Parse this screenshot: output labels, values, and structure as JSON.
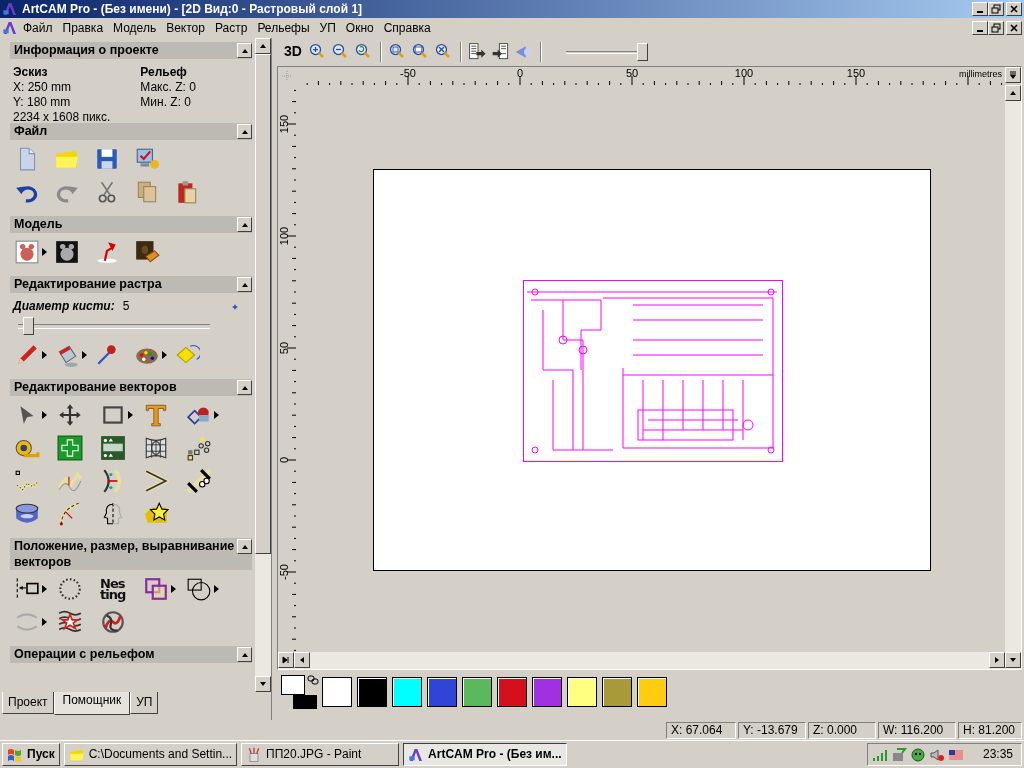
{
  "window": {
    "title": "ArtCAM Pro - (Без имени) - [2D Вид:0 - Растровый слой 1]"
  },
  "menu": [
    "Файл",
    "Правка",
    "Модель",
    "Вектор",
    "Растр",
    "Рельефы",
    "УП",
    "Окно",
    "Справка"
  ],
  "toolbar": {
    "mode_label": "3D",
    "zoom_slider": {
      "level": 0.95
    }
  },
  "panel": {
    "project_info": {
      "title": "Информация о проекте",
      "columns": [
        {
          "heading": "Эскиз",
          "lines": [
            "X: 250 mm",
            "Y: 180 mm",
            "2234 x 1608 пикс."
          ]
        },
        {
          "heading": "Рельеф",
          "lines": [
            "Макс. Z: 0",
            "Мин. Z: 0"
          ]
        }
      ]
    },
    "sections": [
      {
        "title": "Файл",
        "kind": "tools"
      },
      {
        "title": "Модель",
        "kind": "tools"
      },
      {
        "title": "Редактирование растра",
        "kind": "brush",
        "brush_label": "Диаметр кисти:",
        "brush_value": "5",
        "level": 0.05
      },
      {
        "title": "Редактирование векторов",
        "kind": "tools"
      },
      {
        "title": "Положение, размер, выравнивание векторов",
        "kind": "tools",
        "nesting_label": [
          "Nes",
          "ting"
        ]
      },
      {
        "title": "Операции с рельефом",
        "kind": "tools"
      }
    ],
    "tabs": [
      {
        "label": "Проект",
        "selected": false
      },
      {
        "label": "Помощник",
        "selected": true
      },
      {
        "label": "УП",
        "selected": false
      }
    ]
  },
  "rulers": {
    "horizontal": [
      "-50",
      "0",
      "50",
      "100",
      "150"
    ],
    "unit": "millimetres",
    "vertical": [
      "150",
      "100",
      "50",
      "0",
      "-50"
    ]
  },
  "palette": {
    "current": [
      {
        "color": "#ffffff"
      },
      {
        "color": "#000000"
      }
    ],
    "swatches": [
      {
        "color": "#ffffff"
      },
      {
        "color": "#000000"
      },
      {
        "color": "#00ffff"
      },
      {
        "color": "#3044d8"
      },
      {
        "color": "#5cb85c"
      },
      {
        "color": "#d4101c"
      },
      {
        "color": "#a030e0"
      },
      {
        "color": "#ffff80"
      },
      {
        "color": "#a89a38"
      },
      {
        "color": "#ffcc10"
      }
    ]
  },
  "status_bar": [
    "X: 67.064",
    "Y: -13.679",
    "Z: 0.000",
    "W: 116.200",
    "H: 81.200"
  ],
  "taskbar": {
    "start_label": "Пуск",
    "tasks": [
      {
        "label": "C:\\Documents and Settin...",
        "selected": false,
        "kind": "folder"
      },
      {
        "label": "ПП20.JPG - Paint",
        "selected": false,
        "kind": "paint"
      },
      {
        "label": "ArtCAM Pro - (Без им...",
        "selected": true,
        "kind": "app"
      }
    ],
    "clock": "23:35"
  }
}
